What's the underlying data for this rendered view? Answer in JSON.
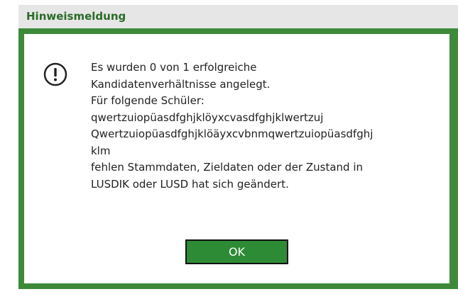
{
  "dialog": {
    "title": "Hinweismeldung",
    "icon": "exclamation-circle-icon",
    "message_lines": [
      "Es wurden 0 von 1 erfolgreiche",
      "Kandidatenverhältnisse angelegt.",
      "Für folgende Schüler:",
      "qwertzuiopüasdfghjklöyxcvasdfghjklwertzuj",
      "Qwertzuiopüasdfghjklöäyxcvbnmqwertzuiopüasdfghj",
      "klm",
      "fehlen Stammdaten, Zieldaten oder der Zustand in",
      "LUSDIK oder LUSD hat sich geändert."
    ],
    "ok_label": "OK"
  },
  "colors": {
    "frame_green": "#3d8a3a",
    "title_text": "#2a6b27",
    "title_bg": "#e6e6e6",
    "button_green": "#2e8b35"
  }
}
